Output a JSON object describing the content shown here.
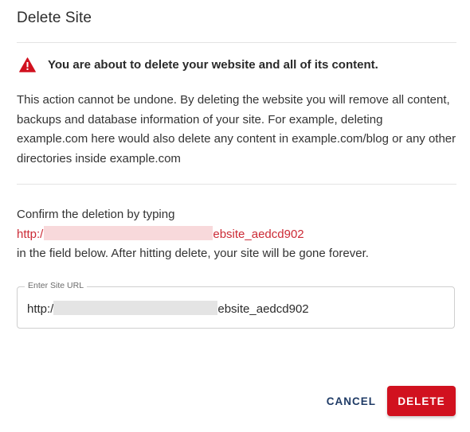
{
  "dialog": {
    "title": "Delete Site",
    "warning": {
      "icon": "warning-triangle-icon",
      "icon_color": "#d1111f",
      "text": "You are about to delete your website and all of its content."
    },
    "description": "This action cannot be undone. By deleting the website you will remove all content, backups and database information of your site. For example, deleting example.com here would also delete any content in example.com/blog or any other directories inside example.com",
    "confirm": {
      "intro": "Confirm the deletion by typing",
      "url_prefix": "http:/",
      "url_suffix": "ebsite_aedcd902",
      "url_color": "#cc2b36",
      "outro": "in the field below. After hitting delete, your site will be gone forever."
    },
    "field": {
      "label": "Enter Site URL",
      "value_prefix": "http:/",
      "value_suffix": "ebsite_aedcd902"
    },
    "buttons": {
      "cancel": "CANCEL",
      "delete": "DELETE",
      "delete_color": "#d1111f",
      "cancel_color": "#1f3b66"
    }
  }
}
